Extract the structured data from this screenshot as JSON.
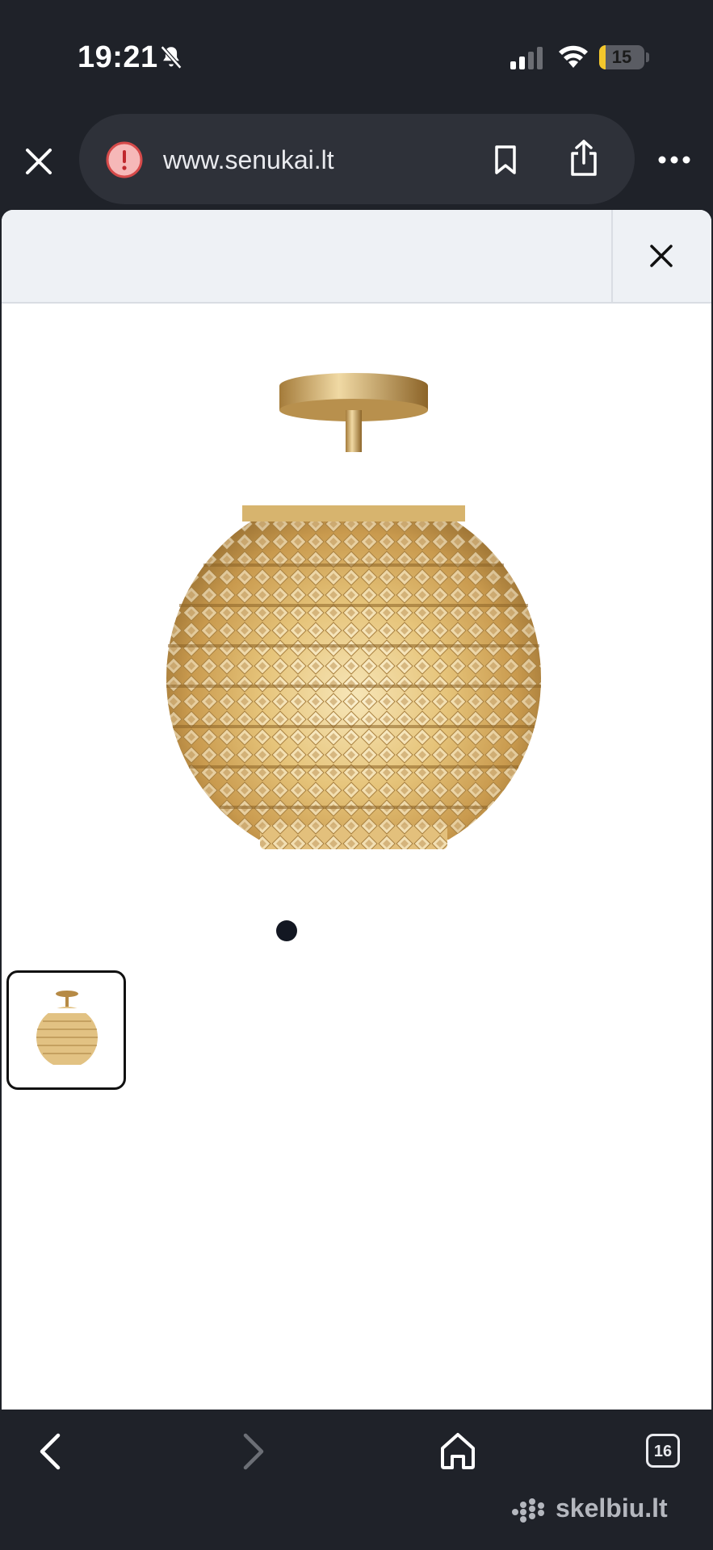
{
  "status_bar": {
    "time": "19:21",
    "battery_level": "15",
    "battery_fraction": 0.15,
    "accent_battery": "#f3c72c"
  },
  "browser": {
    "url": "www.senukai.lt",
    "icons": [
      "close-icon",
      "warning-icon",
      "bookmark-icon",
      "share-icon",
      "more-icon"
    ]
  },
  "gallery": {
    "image_count_dots": 1,
    "active_dot": 1,
    "thumbnails": 1
  },
  "bottom_nav": {
    "tabs_count": "16",
    "icons": [
      "back-icon",
      "forward-icon",
      "home-icon",
      "tabs-icon"
    ]
  },
  "watermark": {
    "text": "skelbiu.lt"
  }
}
